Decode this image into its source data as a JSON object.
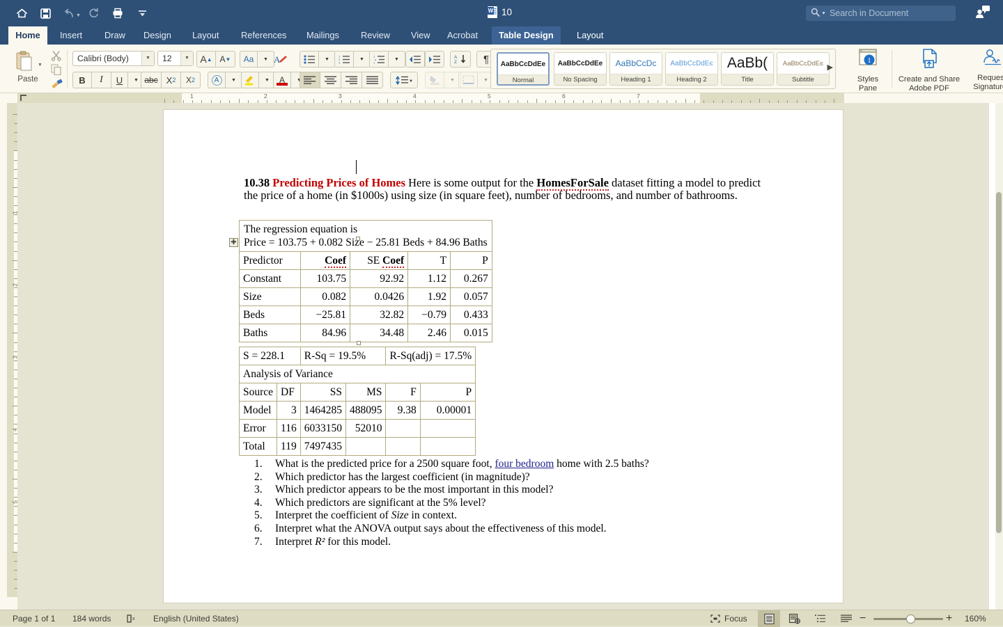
{
  "titlebar": {
    "quick_access": [
      {
        "name": "home-icon",
        "label": "Home"
      },
      {
        "name": "save-icon",
        "label": "Save"
      },
      {
        "name": "undo-icon",
        "label": "Undo"
      },
      {
        "name": "redo-icon",
        "label": "Redo"
      },
      {
        "name": "print-icon",
        "label": "Print"
      },
      {
        "name": "customize-qat-icon",
        "label": "Customize Quick Access Toolbar"
      }
    ],
    "document_title": "10",
    "search_placeholder": "Search in Document",
    "comments_label": "Comments"
  },
  "tabs": [
    {
      "label": "Home",
      "state": "active"
    },
    {
      "label": "Insert",
      "state": "normal"
    },
    {
      "label": "Draw",
      "state": "normal"
    },
    {
      "label": "Design",
      "state": "normal"
    },
    {
      "label": "Layout",
      "state": "normal"
    },
    {
      "label": "References",
      "state": "normal"
    },
    {
      "label": "Mailings",
      "state": "normal"
    },
    {
      "label": "Review",
      "state": "normal"
    },
    {
      "label": "View",
      "state": "normal"
    },
    {
      "label": "Acrobat",
      "state": "normal"
    },
    {
      "label": "Table Design",
      "state": "contextual"
    },
    {
      "label": "Layout",
      "state": "contextual-sibling"
    }
  ],
  "share": {
    "label": "Share",
    "collapse_icon": "chevron-up-icon"
  },
  "ribbon": {
    "paste": {
      "label": "Paste",
      "cut_label": "Cut",
      "copy_label": "Copy",
      "format_painter_label": "Format Painter"
    },
    "font": {
      "family": "Calibri (Body)",
      "size": "12",
      "grow_label": "A",
      "shrink_label": "A",
      "change_case_label": "Aa",
      "clear_formatting_label": "Clear Formatting",
      "bold_label": "B",
      "italic_label": "I",
      "underline_label": "U",
      "strikethrough_label": "abc",
      "subscript_label": "X",
      "subscript_sub": "2",
      "superscript_label": "X",
      "superscript_sup": "2",
      "text_effects_label": "A",
      "highlight_label": "Text Highlight Color",
      "font_color_label": "A"
    },
    "paragraph": {
      "bullets_label": "Bullets",
      "numbering_label": "Numbering",
      "multilevel_label": "Multilevel List",
      "decrease_indent_label": "Decrease Indent",
      "increase_indent_label": "Increase Indent",
      "sort_label": "Sort",
      "show_marks_label": "¶",
      "align_left_label": "Align Left",
      "align_center_label": "Center",
      "align_right_label": "Align Right",
      "justify_label": "Justify",
      "line_spacing_label": "Line and Paragraph Spacing",
      "shading_label": "Shading",
      "borders_label": "Borders"
    },
    "styles": [
      {
        "preview": "AaBbCcDdEe",
        "name": "Normal",
        "selected": true
      },
      {
        "preview": "AaBbCcDdEe",
        "name": "No Spacing",
        "selected": false
      },
      {
        "preview": "AaBbCcDc",
        "name": "Heading 1",
        "selected": false
      },
      {
        "preview": "AaBbCcDdEє",
        "name": "Heading 2",
        "selected": false
      },
      {
        "preview": "AaBb(",
        "name": "Title",
        "selected": false
      },
      {
        "preview": "AaBbCcDdEє",
        "name": "Subtitle",
        "selected": false
      }
    ],
    "gallery_more_label": "▶",
    "right_buttons": [
      {
        "line1": "Styles",
        "line2": "Pane",
        "icon": "styles-pane-icon"
      },
      {
        "line1": "Create and Share",
        "line2": "Adobe PDF",
        "icon": "create-pdf-icon"
      },
      {
        "line1": "Request",
        "line2": "Signatures",
        "icon": "request-signatures-icon"
      }
    ]
  },
  "ruler": {
    "horizontal_marks": [
      "1",
      "2",
      "3",
      "4",
      "5",
      "6",
      "7"
    ],
    "vertical_marks": [
      "1",
      "2",
      "3",
      "4",
      "5"
    ]
  },
  "document": {
    "paragraph1": {
      "number": "10.38",
      "title": "Predicting Prices of Homes",
      "text_a": " Here is some output for the ",
      "dataset": "HomesForSale",
      "text_b": " dataset fitting a model to predict the price of a home (in $1000s) using size (in square feet), number of bedrooms, and number of bathrooms."
    },
    "regression": {
      "caption_line1": "The regression equation is",
      "caption_line2": "Price = 103.75 + 0.082 Size − 25.81 Beds + 84.96 Baths",
      "headers": [
        "Predictor",
        "Coef",
        "SE Coef",
        "T",
        "P"
      ],
      "rows": [
        [
          "Constant",
          "103.75",
          "92.92",
          "1.12",
          "0.267"
        ],
        [
          "Size",
          "0.082",
          "0.0426",
          "1.92",
          "0.057"
        ],
        [
          "Beds",
          "−25.81",
          "32.82",
          "−0.79",
          "0.433"
        ],
        [
          "Baths",
          "84.96",
          "34.48",
          "2.46",
          "0.015"
        ]
      ]
    },
    "fitstats": {
      "s": "S = 228.1",
      "rsq": "R-Sq = 19.5%",
      "rsqadj": "R-Sq(adj) = 17.5%"
    },
    "anova": {
      "caption": "Analysis of Variance",
      "headers": [
        "Source",
        "DF",
        "SS",
        "MS",
        "F",
        "P"
      ],
      "rows": [
        [
          "Model",
          "3",
          "1464285",
          "488095",
          "9.38",
          "0.00001"
        ],
        [
          "Error",
          "116",
          "6033150",
          "52010",
          "",
          ""
        ],
        [
          "Total",
          "119",
          "7497435",
          "",
          "",
          ""
        ]
      ]
    },
    "questions": [
      {
        "num": "1.",
        "pre": "What is the predicted price for a 2500 square foot, ",
        "link": "four bedroom",
        "post": " home with 2.5 baths?"
      },
      {
        "num": "2.",
        "pre": "Which predictor has the largest coefficient (in magnitude)?",
        "link": "",
        "post": ""
      },
      {
        "num": "3.",
        "pre": "Which predictor appears to be the most important in this model?",
        "link": "",
        "post": ""
      },
      {
        "num": "4.",
        "pre": "Which predictors are significant at the 5% level?",
        "link": "",
        "post": ""
      },
      {
        "num": "5.",
        "pre": "Interpret the coefficient of ",
        "italic": "Size",
        "post": " in context."
      },
      {
        "num": "6.",
        "pre": "Interpret what the ANOVA output says about the effectiveness of this model.",
        "link": "",
        "post": ""
      },
      {
        "num": "7.",
        "pre": "Interpret ",
        "italic": "R²",
        "post": " for this model."
      }
    ]
  },
  "statusbar": {
    "page": "Page 1 of 1",
    "words": "184 words",
    "proofing_icon": "spelling-check-icon",
    "language": "English (United States)",
    "focus": "Focus",
    "views": [
      {
        "name": "print-layout-view",
        "icon": "print-layout-icon",
        "active": true
      },
      {
        "name": "web-layout-view",
        "icon": "web-layout-icon",
        "active": false
      },
      {
        "name": "outline-view",
        "icon": "outline-icon",
        "active": false
      },
      {
        "name": "draft-view",
        "icon": "draft-icon",
        "active": false
      }
    ],
    "zoom_out": "−",
    "zoom_in": "+",
    "zoom_level": "160%"
  }
}
